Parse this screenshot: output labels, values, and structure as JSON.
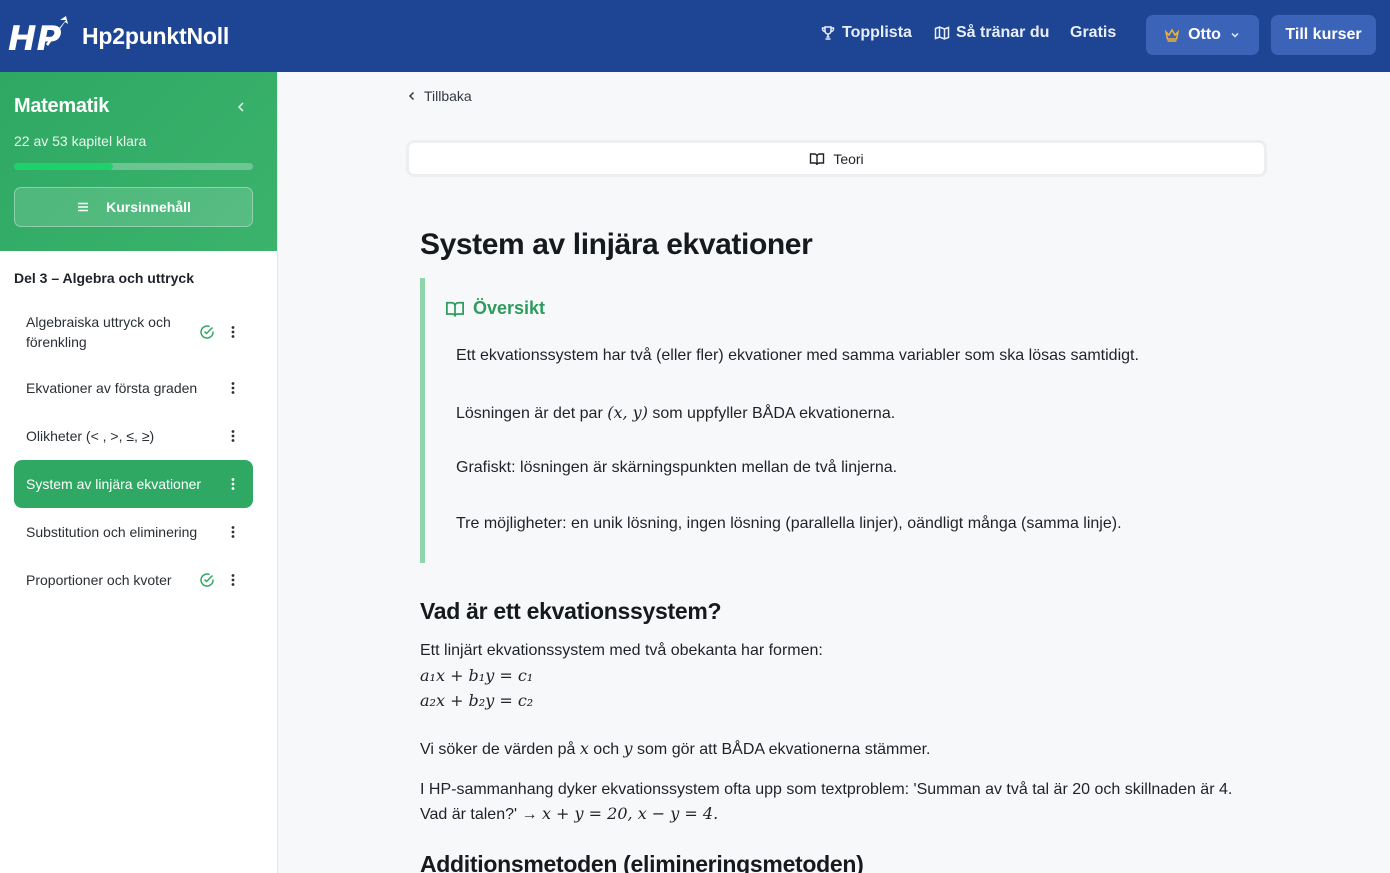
{
  "header": {
    "brand": "Hp2punktNoll",
    "nav": [
      {
        "label": "Topplista",
        "icon": "trophy-icon"
      },
      {
        "label": "Så tränar du",
        "icon": "map-icon"
      },
      {
        "label": "Gratis"
      }
    ],
    "user_name": "Otto",
    "courses_label": "Till kurser"
  },
  "sidebar": {
    "title": "Matematik",
    "progress_text": "22 av 53 kapitel klara",
    "progress_fraction": 0.415,
    "content_button": "Kursinnehåll",
    "section_title": "Del 3 – Algebra och uttryck",
    "items": [
      {
        "label": "Algebraiska uttryck och förenkling",
        "done": true,
        "active": false
      },
      {
        "label": "Ekvationer av första graden",
        "done": false,
        "active": false
      },
      {
        "label": "Olikheter (< , >, ≤, ≥)",
        "done": false,
        "active": false
      },
      {
        "label": "System av linjära ekvationer",
        "done": false,
        "active": true
      },
      {
        "label": "Substitution och eliminering",
        "done": false,
        "active": false
      },
      {
        "label": "Proportioner och kvoter",
        "done": true,
        "active": false
      }
    ],
    "colors": {
      "accent": "#2ea863",
      "done_check": "#2ea863"
    }
  },
  "main": {
    "back_label": "Tillbaka",
    "tab_label": "Teori",
    "title": "System av linjära ekvationer",
    "overview": {
      "heading": "Översikt",
      "p1": "Ett ekvationssystem har två (eller fler) ekvationer med samma variabler som ska lösas samtidigt.",
      "p2_pre": "Lösningen är det par ",
      "p2_math": "(x, y)",
      "p2_post": " som uppfyller BÅDA ekvationerna.",
      "p3": "Grafiskt: lösningen är skärningspunkten mellan de två linjerna.",
      "p4": "Tre möjligheter: en unik lösning, ingen lösning (parallella linjer), oändligt många (samma linje)."
    },
    "section1": {
      "heading": "Vad är ett ekvationssystem?",
      "intro": "Ett linjärt ekvationssystem med två obekanta har formen:",
      "eq1": "a₁x + b₁y = c₁",
      "eq2": "a₂x + b₂y = c₂",
      "p_seek_pre": "Vi söker de värden på ",
      "p_seek_x": "x",
      "p_seek_mid": " och ",
      "p_seek_y": "y",
      "p_seek_post": " som gör att BÅDA ekvationerna stämmer.",
      "p_hp_line1": "I HP-sammanhang dyker ekvationssystem ofta upp som textproblem: 'Summan av två tal är 20 och skillnaden är 4.",
      "p_hp_line2_pre": "Vad är talen?' → ",
      "p_hp_line2_math": "x + y = 20, x − y = 4."
    },
    "section2": {
      "heading": "Additionsmetoden (elimineringsmetoden)"
    }
  }
}
